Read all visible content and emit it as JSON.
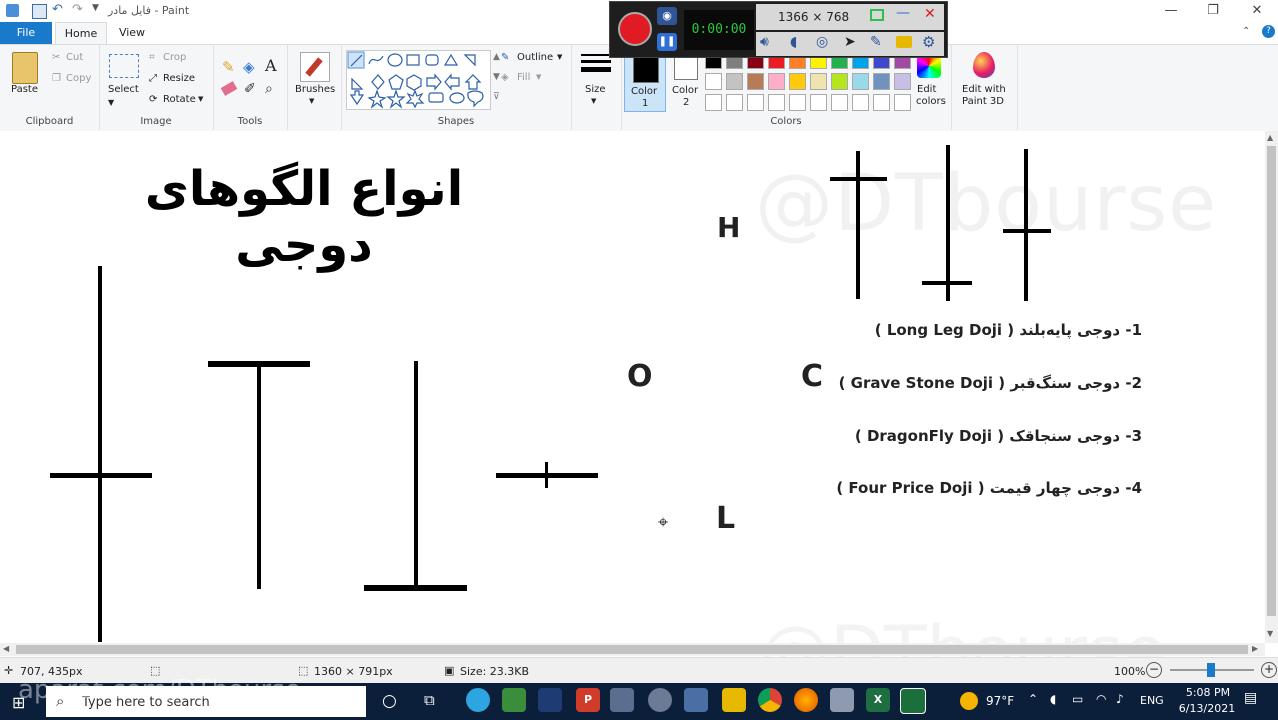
{
  "window": {
    "title": "فایل مادر - Paint",
    "buttons": {
      "minimize": "—",
      "restore": "❐",
      "close": "✕"
    }
  },
  "tabs": {
    "file": "File",
    "home": "Home",
    "view": "View"
  },
  "ribbon": {
    "clipboard": {
      "paste": "Paste",
      "cut": "Cut",
      "copy": "Copy",
      "label": "Clipboard"
    },
    "image": {
      "select": "Select",
      "crop": "Crop",
      "resize": "Resize",
      "rotate": "Rotate",
      "label": "Image"
    },
    "tools": {
      "label": "Tools"
    },
    "brushes": {
      "label": "Brushes"
    },
    "shapes": {
      "outline": "Outline",
      "fill": "Fill",
      "label": "Shapes"
    },
    "size": {
      "label": "Size"
    },
    "colors": {
      "color1": "Color",
      "color1_num": "1",
      "color2": "Color",
      "color2_num": "2",
      "edit": "Edit",
      "edit2": "colors",
      "label": "Colors",
      "palette_row1": [
        "#000000",
        "#7f7f7f",
        "#880015",
        "#ed1c24",
        "#ff7f27",
        "#fff200",
        "#22b14c",
        "#00a2e8",
        "#3f48cc",
        "#a349a4"
      ],
      "palette_row2": [
        "#ffffff",
        "#c3c3c3",
        "#b97a57",
        "#ffaec9",
        "#ffc90e",
        "#efe4b0",
        "#b5e61d",
        "#99d9ea",
        "#7092be",
        "#c8bfe7"
      ],
      "palette_row3": [
        "#ffffff",
        "#ffffff",
        "#ffffff",
        "#ffffff",
        "#ffffff",
        "#ffffff",
        "#ffffff",
        "#ffffff",
        "#ffffff",
        "#ffffff"
      ]
    },
    "paint3d": {
      "line1": "Edit with",
      "line2": "Paint 3D"
    }
  },
  "recorder": {
    "resolution": "1366 × 768",
    "counter": "0:00:00"
  },
  "canvas": {
    "heading": "انواع الگوهای دوجی",
    "watermark": "@DTbourse",
    "letters": {
      "h": "H",
      "o": "O",
      "c": "C",
      "l": "L"
    },
    "items": [
      "1- دوجی پایه‌بلند  ( Long Leg Doji )",
      "2- دوجی سنگ‌قبر  ( Grave Stone Doji )",
      "3- دوجی سنجاقک  ( DragonFly Doji )",
      "4- دوجی چهار قیمت ( Four Price Doji )"
    ]
  },
  "status": {
    "cursor": "707, 435px",
    "dimensions": "1360 × 791px",
    "size": "Size: 23.3KB",
    "zoom": "100%"
  },
  "taskbar": {
    "search_placeholder": "Type here to search",
    "watermark": "aparat.com/DTbourse",
    "weather": "97°F",
    "lang": "ENG",
    "time": "5:08 PM",
    "date": "6/13/2021"
  }
}
